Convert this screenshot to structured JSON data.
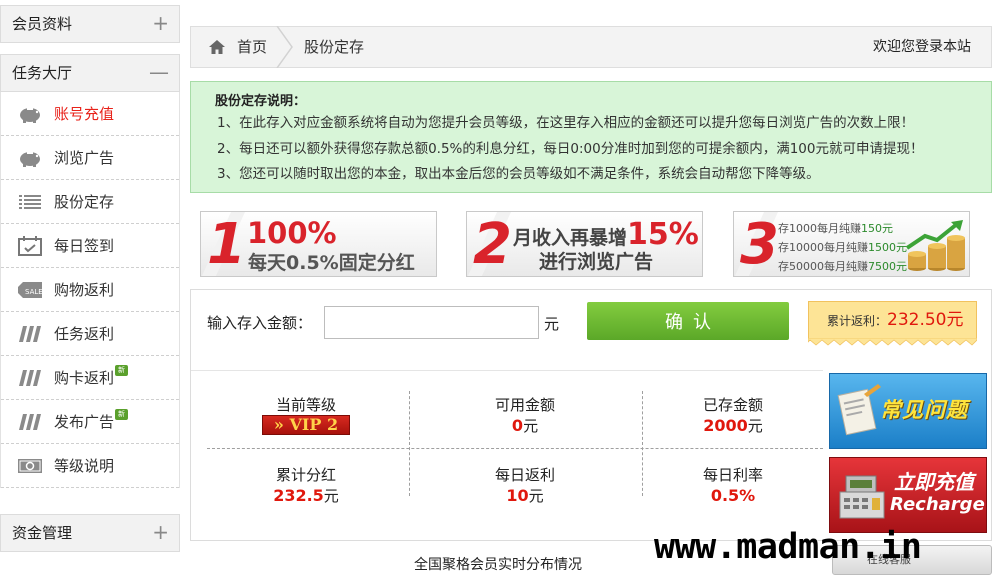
{
  "sidebar": {
    "sections": [
      {
        "label": "会员资料",
        "toggle": "+"
      },
      {
        "label": "任务大厅",
        "toggle": "—"
      },
      {
        "label": "资金管理",
        "toggle": "+"
      }
    ],
    "items": [
      {
        "label": "账号充值",
        "icon": "piggy-bank-icon",
        "active": true,
        "new": false
      },
      {
        "label": "浏览广告",
        "icon": "piggy-bank-icon",
        "active": false,
        "new": false
      },
      {
        "label": "股份定存",
        "icon": "list-icon",
        "active": false,
        "new": false
      },
      {
        "label": "每日签到",
        "icon": "calendar-icon",
        "active": false,
        "new": false
      },
      {
        "label": "购物返利",
        "icon": "sale-tag-icon",
        "active": false,
        "new": false
      },
      {
        "label": "任务返利",
        "icon": "coins-stack-icon",
        "active": false,
        "new": false
      },
      {
        "label": "购卡返利",
        "icon": "coins-stack-icon",
        "active": false,
        "new": true
      },
      {
        "label": "发布广告",
        "icon": "coins-stack-icon",
        "active": false,
        "new": true
      },
      {
        "label": "等级说明",
        "icon": "cash-icon",
        "active": false,
        "new": false
      }
    ],
    "new_badge": "新"
  },
  "breadcrumb": {
    "home": "首页",
    "current": "股份定存",
    "welcome": "欢迎您登录本站"
  },
  "notice": {
    "title": "股份定存说明：",
    "lines": [
      "1、在此存入对应金额系统将自动为您提升会员等级，在这里存入相应的金额还可以提升您每日浏览广告的次数上限！",
      "2、每日还可以额外获得您存款总额0.5%的利息分红，每日0:00分准时加到您的可提余额内，满100元就可申请提现！",
      "3、您还可以随时取出您的本金，取出本金后您的会员等级如不满足条件，系统会自动帮您下降等级。"
    ]
  },
  "banners": {
    "b1": {
      "num": "1",
      "big": "100%",
      "sub": "每天0.5%固定分红"
    },
    "b2": {
      "num": "2",
      "l1_text": "月收入再暴增",
      "l1_pct": "15%",
      "l2": "进行浏览广告"
    },
    "b3": {
      "num": "3",
      "rows": [
        {
          "pre": "存1000每月纯赚",
          "hl": "150元"
        },
        {
          "pre": "存10000每月纯赚",
          "hl": "1500元"
        },
        {
          "pre": "存50000每月纯赚",
          "hl": "7500元"
        }
      ]
    }
  },
  "deposit": {
    "label": "输入存入金额：",
    "value": "",
    "placeholder": "",
    "unit": "元",
    "confirm": "确认",
    "rebate_label": "累计返利：",
    "rebate_value": "232.50元"
  },
  "stats": {
    "level_label": "当前等级",
    "level_value": "» VIP 2",
    "available_label": "可用金额",
    "available_value": "0",
    "stored_label": "已存金额",
    "stored_value": "2000",
    "dividend_label": "累计分红",
    "dividend_value": "232.5",
    "daily_rebate_label": "每日返利",
    "daily_rebate_value": "10",
    "daily_rate_label": "每日利率",
    "daily_rate_value": "0.5%",
    "unit": "元"
  },
  "side_buttons": {
    "faq": "常见问题",
    "recharge_cn": "立即充值",
    "recharge_en": "Recharge"
  },
  "bottom": {
    "caption": "全国聚格会员实时分布情况",
    "watermark": "www.madman.in",
    "chat": "在线客服"
  },
  "colors": {
    "accent_red": "#e0180d",
    "confirm_green": "#6cb82f",
    "notice_bg": "#d8f5d8",
    "rebate_bg": "#fde496"
  }
}
